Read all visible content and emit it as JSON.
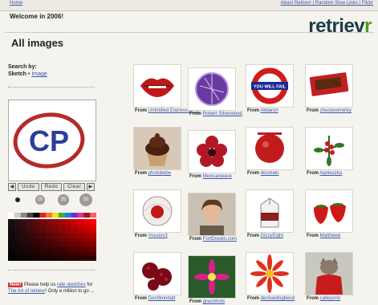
{
  "header": {
    "home_link": "Home",
    "top_links": "About Retrievr | Random Slow Links | Flickr",
    "welcome": "Welcome in 2006!",
    "logo_main": "retriev",
    "logo_accent": "r",
    "brand_color": "#1d3c49",
    "accent_color": "#4a9a1f"
  },
  "page": {
    "title": "All images"
  },
  "search": {
    "label": "Search by:",
    "sketch": "Sketch",
    "separator": " • ",
    "image": "Image"
  },
  "sketch_text": "CP",
  "toolbar": {
    "prev_icon": "◀",
    "undo": "Undo",
    "redo": "Redo",
    "clear": "Clear",
    "next_icon": "▶"
  },
  "brushes": [
    "20",
    "35",
    "50"
  ],
  "new_note": {
    "badge": "New!",
    "text_before": " Please help us ",
    "link1": "rate sketches",
    "text_mid": " for ",
    "link2": "The Art of retrievr",
    "text_after": "! Only a million to go ..."
  },
  "results": [
    {
      "subject": "red-lips",
      "from_label": "From",
      "user": "Unbridled Expression ..."
    },
    {
      "subject": "purple-orb",
      "from_label": "From",
      "user": "Robert Silverwood"
    },
    {
      "subject": "you-will-fail-sign",
      "from_label": "From",
      "user": "Akbaron"
    },
    {
      "subject": "chocolate-bar",
      "from_label": "From",
      "user": "chuckewmeloy"
    },
    {
      "subject": "cupcake",
      "from_label": "From",
      "user": "photobebe"
    },
    {
      "subject": "red-flower-cookie",
      "from_label": "From",
      "user": "Mexicanwave"
    },
    {
      "subject": "red-berry-ball",
      "from_label": "From",
      "user": "docmain"
    },
    {
      "subject": "berry-sprig",
      "from_label": "From",
      "user": "Agnieszka"
    },
    {
      "subject": "glass-sphere",
      "from_label": "From",
      "user": "Vossiov3"
    },
    {
      "subject": "portrait",
      "from_label": "From",
      "user": "FortDrexlin.com"
    },
    {
      "subject": "milk-carton",
      "from_label": "From",
      "user": "DizzyEight"
    },
    {
      "subject": "strawberries",
      "from_label": "From",
      "user": "Matthewk"
    },
    {
      "subject": "raspberries",
      "from_label": "From",
      "user": "GenWondatt"
    },
    {
      "subject": "magenta-flower",
      "from_label": "From",
      "user": "gracinhols"
    },
    {
      "subject": "red-daisy",
      "from_label": "From",
      "user": "denisedingbend"
    },
    {
      "subject": "cat-in-sweater",
      "from_label": "From",
      "user": "calleyorin"
    }
  ]
}
